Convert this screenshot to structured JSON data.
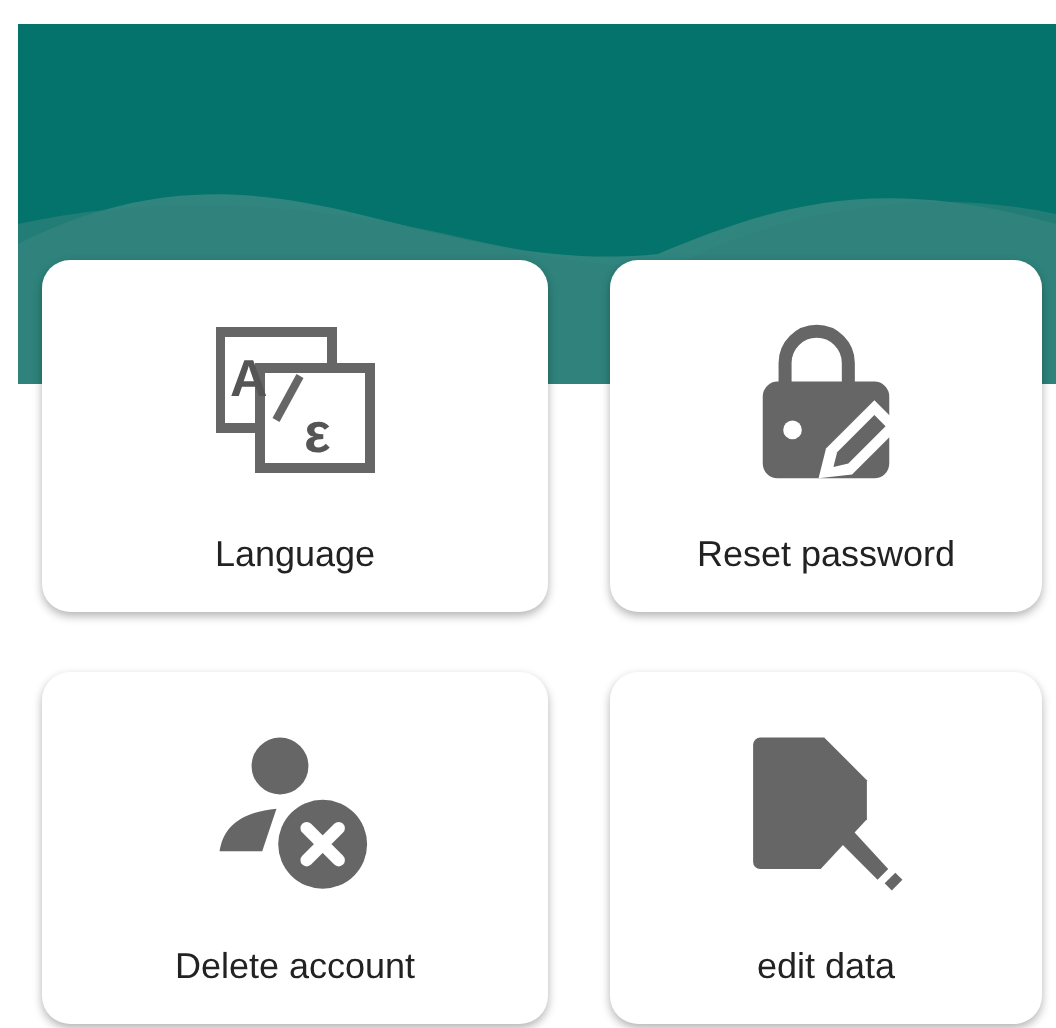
{
  "cards": [
    {
      "kind": "language",
      "label": "Language",
      "glyphs": [
        "A",
        "ε"
      ]
    },
    {
      "kind": "lock",
      "label": "Reset password"
    },
    {
      "kind": "delete-user",
      "label": "Delete account"
    },
    {
      "kind": "edit-file",
      "label": "edit data"
    }
  ]
}
